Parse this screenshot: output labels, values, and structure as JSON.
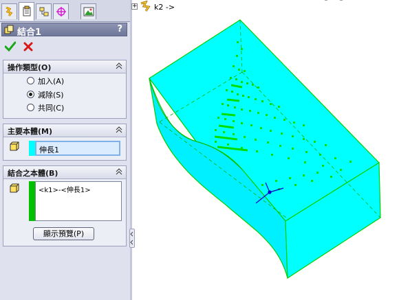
{
  "panel": {
    "tabs": [
      {
        "name": "feature-manager-tab",
        "icon": "feature-tree-icon"
      },
      {
        "name": "property-manager-tab",
        "icon": "property-sheet-icon",
        "active": true
      },
      {
        "name": "configuration-manager-tab",
        "icon": "configuration-icon"
      },
      {
        "name": "dimxpert-tab",
        "icon": "crosshair-icon"
      },
      {
        "name": "display-manager-tab",
        "icon": "display-icon"
      }
    ],
    "title": "結合1",
    "help": "?",
    "operation": {
      "title": "操作類型(O)",
      "options": [
        {
          "label": "加入(A)",
          "checked": false
        },
        {
          "label": "減除(S)",
          "checked": true
        },
        {
          "label": "共同(C)",
          "checked": false
        }
      ]
    },
    "main_body": {
      "title": "主要本體(M)",
      "value": "伸長1",
      "color": "#00ffff"
    },
    "combine_bodies": {
      "title": "結合之本體(B)",
      "items": [
        "<k1>-<伸長1>"
      ],
      "color": "#00c000"
    },
    "preview_button": "顯示預覽(P)"
  },
  "graphics": {
    "tree_label": "k2 ->",
    "model_color": "#00ffff",
    "edge_color": "#00d000"
  }
}
